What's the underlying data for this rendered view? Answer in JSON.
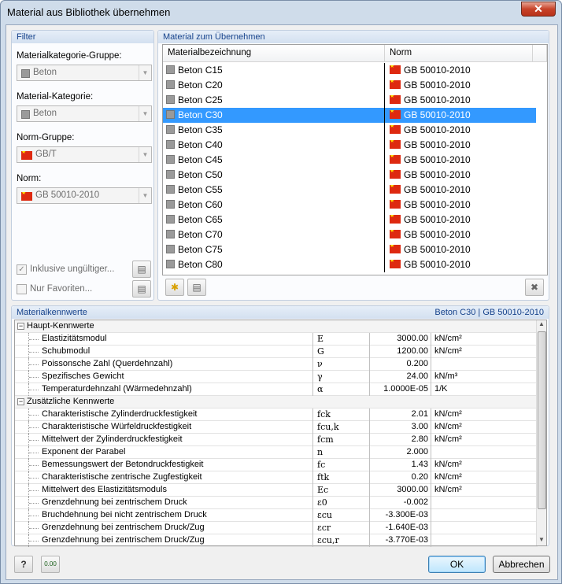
{
  "window": {
    "title": "Material aus Bibliothek übernehmen",
    "close_glyph": "✕"
  },
  "filter": {
    "heading": "Filter",
    "group_label": "Materialkategorie-Gruppe:",
    "group_value": "Beton",
    "category_label": "Material-Kategorie:",
    "category_value": "Beton",
    "norm_group_label": "Norm-Gruppe:",
    "norm_group_value": "GB/T",
    "norm_label": "Norm:",
    "norm_value": "GB 50010-2010",
    "include_invalid": "Inklusive ungültiger...",
    "favorites_only": "Nur Favoriten..."
  },
  "materials": {
    "heading": "Material zum Übernehmen",
    "col_name": "Materialbezeichnung",
    "col_norm": "Norm",
    "rows": [
      {
        "name": "Beton C15",
        "norm": "GB 50010-2010"
      },
      {
        "name": "Beton C20",
        "norm": "GB 50010-2010"
      },
      {
        "name": "Beton C25",
        "norm": "GB 50010-2010"
      },
      {
        "name": "Beton C30",
        "norm": "GB 50010-2010"
      },
      {
        "name": "Beton C35",
        "norm": "GB 50010-2010"
      },
      {
        "name": "Beton C40",
        "norm": "GB 50010-2010"
      },
      {
        "name": "Beton C45",
        "norm": "GB 50010-2010"
      },
      {
        "name": "Beton C50",
        "norm": "GB 50010-2010"
      },
      {
        "name": "Beton C55",
        "norm": "GB 50010-2010"
      },
      {
        "name": "Beton C60",
        "norm": "GB 50010-2010"
      },
      {
        "name": "Beton C65",
        "norm": "GB 50010-2010"
      },
      {
        "name": "Beton C70",
        "norm": "GB 50010-2010"
      },
      {
        "name": "Beton C75",
        "norm": "GB 50010-2010"
      },
      {
        "name": "Beton C80",
        "norm": "GB 50010-2010"
      }
    ],
    "selected_index": 3
  },
  "props": {
    "heading": "Materialkennwerte",
    "selection": "Beton C30  |  GB 50010-2010",
    "sections": [
      {
        "title": "Haupt-Kennwerte",
        "rows": [
          {
            "name": "Elastizitätsmodul",
            "sym": "E",
            "val": "3000.00",
            "unit": "kN/cm²"
          },
          {
            "name": "Schubmodul",
            "sym": "G",
            "val": "1200.00",
            "unit": "kN/cm²"
          },
          {
            "name": "Poissonsche Zahl (Querdehnzahl)",
            "sym": "ν",
            "val": "0.200",
            "unit": ""
          },
          {
            "name": "Spezifisches Gewicht",
            "sym": "γ",
            "val": "24.00",
            "unit": "kN/m³"
          },
          {
            "name": "Temperaturdehnzahl (Wärmedehnzahl)",
            "sym": "α",
            "val": "1.0000E-05",
            "unit": "1/K"
          }
        ]
      },
      {
        "title": "Zusätzliche Kennwerte",
        "rows": [
          {
            "name": "Charakteristische Zylinderdruckfestigkeit",
            "sym": "fck",
            "val": "2.01",
            "unit": "kN/cm²"
          },
          {
            "name": "Charakteristische Würfeldruckfestigkeit",
            "sym": "fcu,k",
            "val": "3.00",
            "unit": "kN/cm²"
          },
          {
            "name": "Mittelwert der Zylinderdruckfestigkeit",
            "sym": "fcm",
            "val": "2.80",
            "unit": "kN/cm²"
          },
          {
            "name": "Exponent der Parabel",
            "sym": "n",
            "val": "2.000",
            "unit": ""
          },
          {
            "name": "Bemessungswert der Betondruckfestigkeit",
            "sym": "fc",
            "val": "1.43",
            "unit": "kN/cm²"
          },
          {
            "name": "Charakteristische zentrische Zugfestigkeit",
            "sym": "ftk",
            "val": "0.20",
            "unit": "kN/cm²"
          },
          {
            "name": "Mittelwert des Elastizitätsmoduls",
            "sym": "Ec",
            "val": "3000.00",
            "unit": "kN/cm²"
          },
          {
            "name": "Grenzdehnung bei zentrischem Druck",
            "sym": "ε0",
            "val": "-0.002",
            "unit": ""
          },
          {
            "name": "Bruchdehnung bei nicht zentrischem Druck",
            "sym": "εcu",
            "val": "-3.300E-03",
            "unit": ""
          },
          {
            "name": "Grenzdehnung bei zentrischem Druck/Zug",
            "sym": "εcr",
            "val": "-1.640E-03",
            "unit": ""
          },
          {
            "name": "Grenzdehnung bei zentrischem Druck/Zug",
            "sym": "εcu,r",
            "val": "-3.770E-03",
            "unit": ""
          }
        ]
      }
    ]
  },
  "footer": {
    "ok": "OK",
    "cancel": "Abbrechen",
    "help_glyph": "?",
    "units_glyph": "0.00"
  }
}
